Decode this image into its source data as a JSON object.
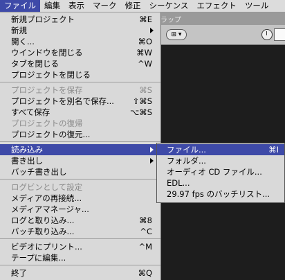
{
  "menubar": {
    "items": [
      "ファイル",
      "編集",
      "表示",
      "マーク",
      "修正",
      "シーケンス",
      "エフェクト",
      "ツール"
    ]
  },
  "background": {
    "tab_label": "ラップ",
    "popup_label": "⊞ ▾"
  },
  "file_menu": {
    "items": [
      {
        "label": "新規プロジェクト",
        "shortcut": "⌘E"
      },
      {
        "label": "新規",
        "shortcut": ""
      },
      {
        "label": "開く...",
        "shortcut": "⌘O"
      },
      {
        "label": "ウインドウを閉じる",
        "shortcut": "⌘W"
      },
      {
        "label": "タブを閉じる",
        "shortcut": "^W"
      },
      {
        "label": "プロジェクトを閉じる",
        "shortcut": ""
      },
      {
        "label": "プロジェクトを保存",
        "shortcut": "⌘S"
      },
      {
        "label": "プロジェクトを別名で保存...",
        "shortcut": "⇧⌘S"
      },
      {
        "label": "すべて保存",
        "shortcut": "⌥⌘S"
      },
      {
        "label": "プロジェクトの復帰",
        "shortcut": ""
      },
      {
        "label": "プロジェクトの復元...",
        "shortcut": ""
      },
      {
        "label": "読み込み",
        "shortcut": ""
      },
      {
        "label": "書き出し",
        "shortcut": ""
      },
      {
        "label": "バッチ書き出し",
        "shortcut": ""
      },
      {
        "label": "ログビンとして設定",
        "shortcut": ""
      },
      {
        "label": "メディアの再接続...",
        "shortcut": ""
      },
      {
        "label": "メディアマネージャ...",
        "shortcut": ""
      },
      {
        "label": "ログと取り込み...",
        "shortcut": "⌘8"
      },
      {
        "label": "バッチ取り込み...",
        "shortcut": "^C"
      },
      {
        "label": "ビデオにプリント...",
        "shortcut": "^M"
      },
      {
        "label": "テープに編集...",
        "shortcut": ""
      },
      {
        "label": "終了",
        "shortcut": "⌘Q"
      }
    ]
  },
  "import_submenu": {
    "items": [
      {
        "label": "ファイル...",
        "shortcut": "⌘I"
      },
      {
        "label": "フォルダ...",
        "shortcut": ""
      },
      {
        "label": "オーディオ CD ファイル...",
        "shortcut": ""
      },
      {
        "label": "EDL...",
        "shortcut": ""
      },
      {
        "label": "29.97 fps のバッチリスト...",
        "shortcut": ""
      }
    ]
  }
}
